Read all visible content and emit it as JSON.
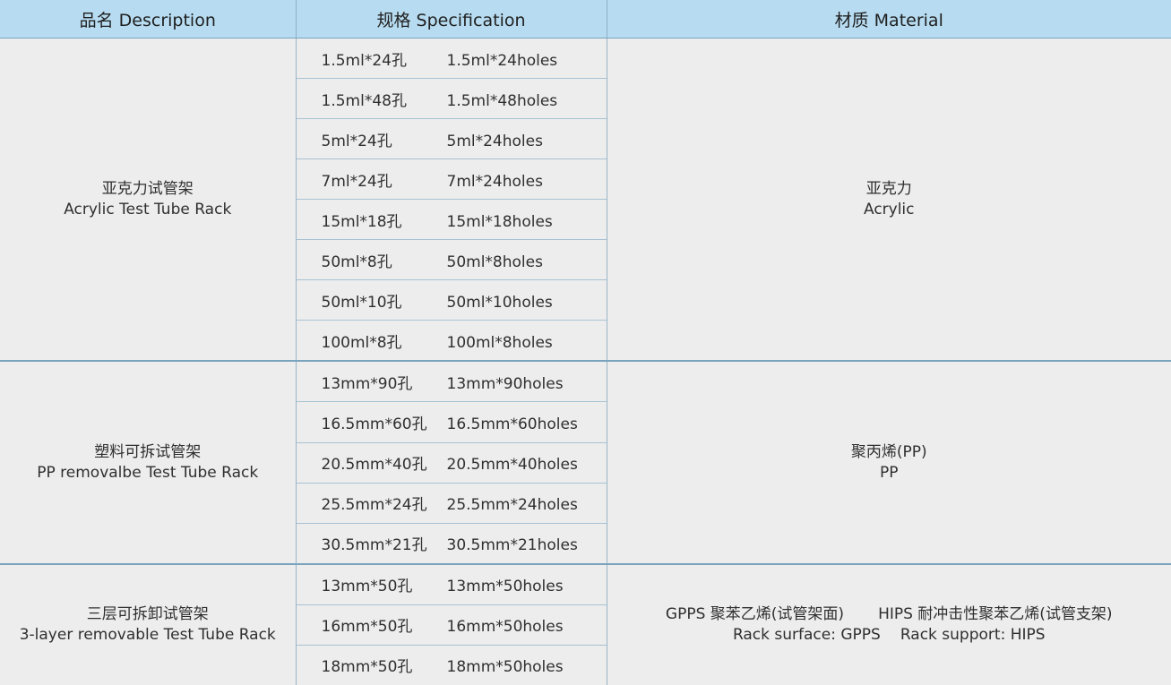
{
  "header": {
    "description": "品名 Description",
    "specification": "规格 Specification",
    "material": "材质 Material"
  },
  "groups": [
    {
      "name_cn": "亚克力试管架",
      "name_en": "Acrylic Test Tube Rack",
      "material_cn": "亚克力",
      "material_en": "Acrylic",
      "specs": [
        {
          "cn": "1.5ml*24孔",
          "en": "1.5ml*24holes"
        },
        {
          "cn": "1.5ml*48孔",
          "en": "1.5ml*48holes"
        },
        {
          "cn": "5ml*24孔",
          "en": "5ml*24holes"
        },
        {
          "cn": "7ml*24孔",
          "en": "7ml*24holes"
        },
        {
          "cn": "15ml*18孔",
          "en": "15ml*18holes"
        },
        {
          "cn": "50ml*8孔",
          "en": "50ml*8holes"
        },
        {
          "cn": "50ml*10孔",
          "en": "50ml*10holes"
        },
        {
          "cn": "100ml*8孔",
          "en": "100ml*8holes"
        }
      ]
    },
    {
      "name_cn": "塑料可拆试管架",
      "name_en": "PP removalbe Test Tube Rack",
      "material_cn": "聚丙烯(PP)",
      "material_en": "PP",
      "specs": [
        {
          "cn": "13mm*90孔",
          "en": "13mm*90holes"
        },
        {
          "cn": "16.5mm*60孔",
          "en": "16.5mm*60holes"
        },
        {
          "cn": "20.5mm*40孔",
          "en": "20.5mm*40holes"
        },
        {
          "cn": "25.5mm*24孔",
          "en": "25.5mm*24holes"
        },
        {
          "cn": "30.5mm*21孔",
          "en": "30.5mm*21holes"
        }
      ]
    },
    {
      "name_cn": "三层可拆卸试管架",
      "name_en": "3-layer removable Test Tube Rack",
      "material_cn_a": "GPPS 聚苯乙烯(试管架面)",
      "material_cn_b": "HIPS 耐冲击性聚苯乙烯(试管支架)",
      "material_en_a": "Rack surface: GPPS",
      "material_en_b": "Rack support: HIPS",
      "specs": [
        {
          "cn": "13mm*50孔",
          "en": "13mm*50holes"
        },
        {
          "cn": "16mm*50孔",
          "en": "16mm*50holes"
        },
        {
          "cn": "18mm*50孔",
          "en": "18mm*50holes"
        }
      ]
    }
  ]
}
